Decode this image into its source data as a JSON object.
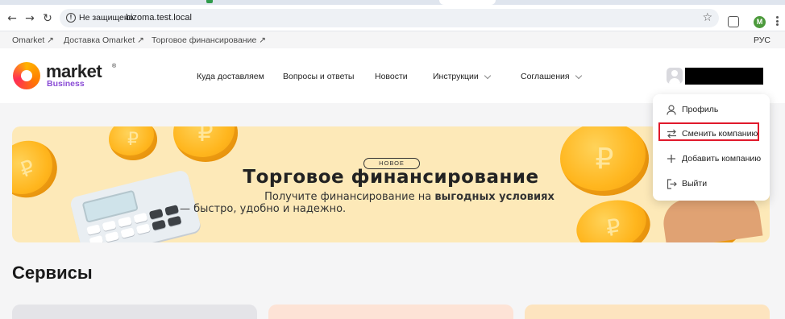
{
  "browser": {
    "security_label": "Не защищено",
    "url": "bizoma.test.local",
    "profile_initial": "M"
  },
  "toplinks": {
    "items": [
      "Omarket ↗",
      "Доставка Omarket ↗",
      "Торговое финансирование ↗"
    ],
    "language": "РУС"
  },
  "header": {
    "logo_word": "market",
    "logo_reg": "®",
    "logo_sub": "Business",
    "nav": [
      "Куда доставляем",
      "Вопросы и ответы",
      "Новости",
      "Инструкции",
      "Соглашения"
    ]
  },
  "banner": {
    "badge": "НОВОЕ",
    "title": "Торговое финансирование",
    "subtitle_pre": "Получите финансирование на ",
    "subtitle_bold": "выгодных условиях",
    "subtitle_line2": "— быстро, удобно и надежно."
  },
  "services": {
    "title": "Сервисы",
    "card_colors": [
      "#e4e4e8",
      "#fde3d6",
      "#fde4bf"
    ]
  },
  "user_menu": {
    "items": [
      {
        "label": "Профиль",
        "icon": "person-icon"
      },
      {
        "label": "Сменить компанию",
        "icon": "swap-arrows-icon"
      },
      {
        "label": "Добавить компанию",
        "icon": "plus-icon"
      },
      {
        "label": "Выйти",
        "icon": "logout-icon"
      }
    ],
    "highlight_color": "#e0192b"
  }
}
